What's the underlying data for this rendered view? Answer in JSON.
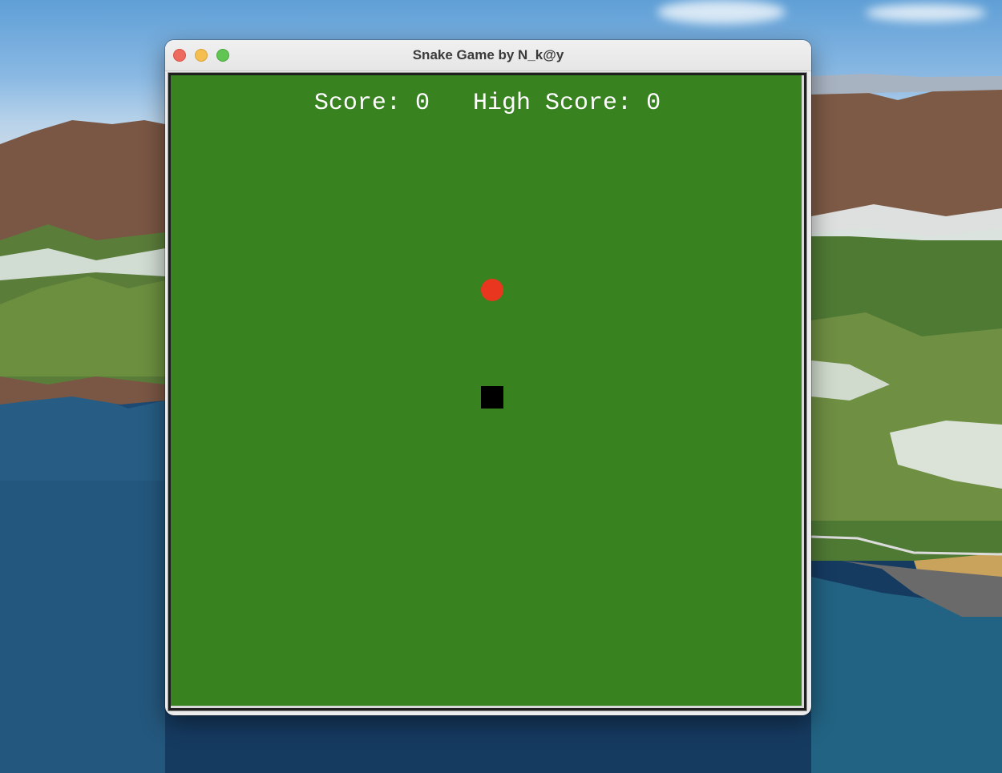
{
  "window": {
    "title": "Snake Game by N_k@y"
  },
  "game": {
    "score_label": "Score:",
    "score": "0",
    "high_score_label": "High Score:",
    "high_score": "0",
    "background_color": "#388220",
    "food_color": "#e8361f",
    "snake_color": "#000000"
  }
}
